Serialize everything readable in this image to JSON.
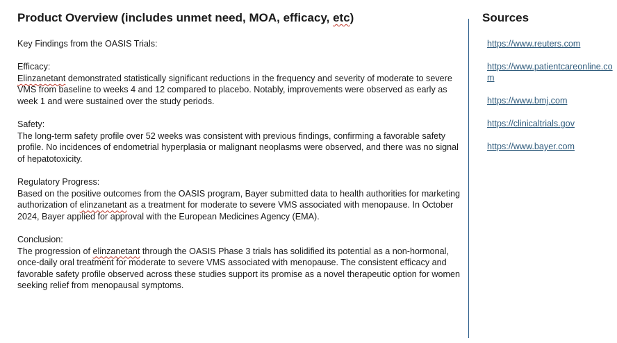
{
  "main": {
    "title_prefix": "Product Overview (includes unmet need, MOA, efficacy, ",
    "title_misspelled": "etc",
    "title_suffix": ")",
    "intro": "Key Findings from the OASIS Trials:",
    "efficacy": {
      "heading": "Efficacy:",
      "drug_name": "Elinzanetant",
      "text": " demonstrated statistically significant reductions in the frequency and severity of moderate to severe VMS from baseline to weeks 4 and 12 compared to placebo. Notably, improvements were observed as early as week 1 and were sustained over the study periods."
    },
    "safety": {
      "heading": "Safety:",
      "text": "The long-term safety profile over 52 weeks was consistent with previous findings, confirming a favorable safety profile. No incidences of endometrial hyperplasia or malignant neoplasms were observed, and there was no signal of hepatotoxicity."
    },
    "regulatory": {
      "heading": "Regulatory Progress:",
      "text_before": "Based on the positive outcomes from the OASIS program, Bayer submitted data to health authorities for marketing authorization of ",
      "drug_name": "elinzanetant",
      "text_after": " as a treatment for moderate to severe VMS associated with menopause. In October 2024, Bayer applied for approval with the European Medicines Agency (EMA)."
    },
    "conclusion": {
      "heading": "Conclusion:",
      "text_before": "The progression of ",
      "drug_name": "elinzanetant",
      "text_after": " through the OASIS Phase 3 trials has solidified its potential as a non-hormonal, once-daily oral treatment for moderate to severe VMS associated with menopause. The consistent efficacy and favorable safety profile observed across these studies support its promise as a novel therapeutic option for women seeking relief from menopausal symptoms."
    }
  },
  "sources": {
    "title": "Sources",
    "links": [
      "https://www.reuters.com",
      "https://www.patientcareonline.com",
      "https://www.bmj.com",
      "https://clinicaltrials.gov",
      "https://www.bayer.com"
    ]
  }
}
